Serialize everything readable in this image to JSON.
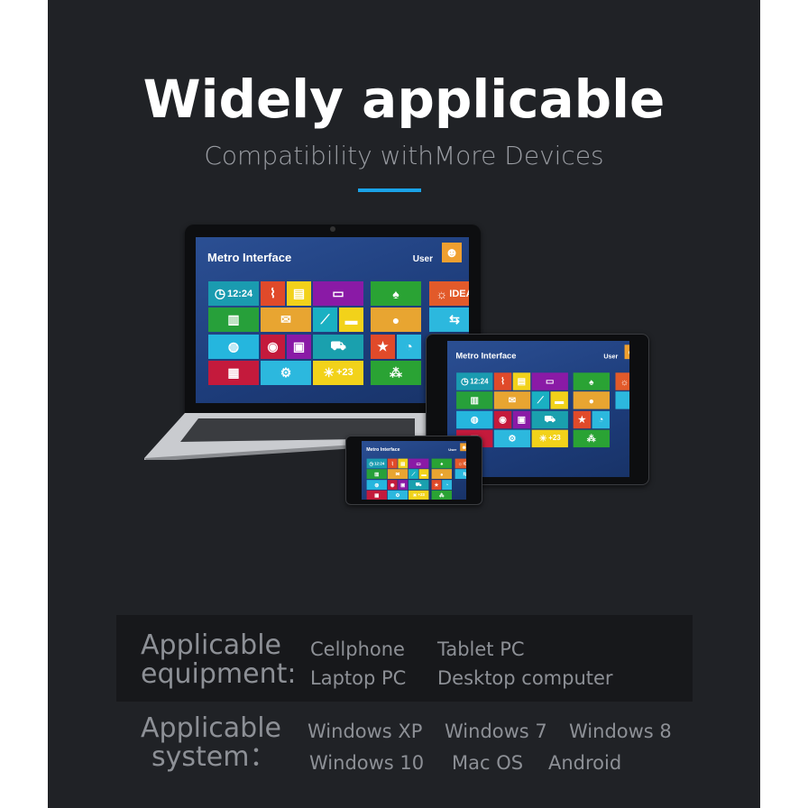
{
  "header": {
    "title": "Widely applicable",
    "subtitle": "Compatibility withMore Devices",
    "accent_color": "#1aa3e8"
  },
  "metro": {
    "title": "Metro Interface",
    "user": "User",
    "tiles": [
      {
        "color": "#1a9bb0",
        "icon": "clock-icon",
        "glyph": "◷",
        "label": "12:24"
      },
      {
        "color": "#e04a2a",
        "icon": "chart-icon",
        "glyph": "⌇"
      },
      {
        "color": "#f2d21a",
        "icon": "document-icon",
        "glyph": "▤"
      },
      {
        "color": "#8a1aa6",
        "icon": "chat-icon",
        "glyph": "▭"
      },
      {
        "color": "#2aa334",
        "icon": "cards-icon",
        "glyph": "♠"
      },
      {
        "color": "#e25a2a",
        "icon": "idea-icon",
        "glyph": "☼",
        "label": "IDEA"
      },
      {
        "color": "#27a03a",
        "icon": "books-icon",
        "glyph": "▥"
      },
      {
        "color": "#e8a531",
        "icon": "mail-icon",
        "glyph": "✉"
      },
      {
        "color": "#1ab0c2",
        "icon": "graph-icon",
        "glyph": "⟋"
      },
      {
        "color": "#f2d21a",
        "icon": "cup-icon",
        "glyph": "▬"
      },
      {
        "color": "#e8a531",
        "icon": "hat-icon",
        "glyph": "●"
      },
      {
        "color": "#2cb8de",
        "icon": "signpost-icon",
        "glyph": "⇆"
      },
      {
        "color": "#25b6de",
        "icon": "globe-icon",
        "glyph": "◍"
      },
      {
        "color": "#c41a3c",
        "icon": "video-camera-icon",
        "glyph": "◉"
      },
      {
        "color": "#8a1aa6",
        "icon": "camera-icon",
        "glyph": "▣"
      },
      {
        "color": "#1aa0ae",
        "icon": "cart-icon",
        "glyph": "⛟"
      },
      {
        "color": "#e04a2a",
        "icon": "star-icon",
        "glyph": "★"
      },
      {
        "color": "#2cb8de",
        "icon": "pie-icon",
        "glyph": "◔"
      },
      {
        "color": "#c41a3c",
        "icon": "calendar-icon",
        "glyph": "▦"
      },
      {
        "color": "#2cb8de",
        "icon": "gears-icon",
        "glyph": "⚙"
      },
      {
        "color": "#f2d21a",
        "icon": "sun-icon",
        "glyph": "☀",
        "label": "+23"
      },
      {
        "color": "#2aa334",
        "icon": "balls-icon",
        "glyph": "⁂"
      }
    ]
  },
  "equipment": {
    "label_line1": "Applicable",
    "label_line2": "equipment:",
    "items": [
      "Cellphone",
      "Tablet PC",
      "Laptop PC",
      "Desktop computer"
    ]
  },
  "system": {
    "label_line1": "Applicable",
    "label_line2": "system：",
    "items": [
      "Windows XP",
      "Windows 7",
      "Windows 8",
      "Windows 10",
      "Mac OS",
      "Android"
    ]
  }
}
